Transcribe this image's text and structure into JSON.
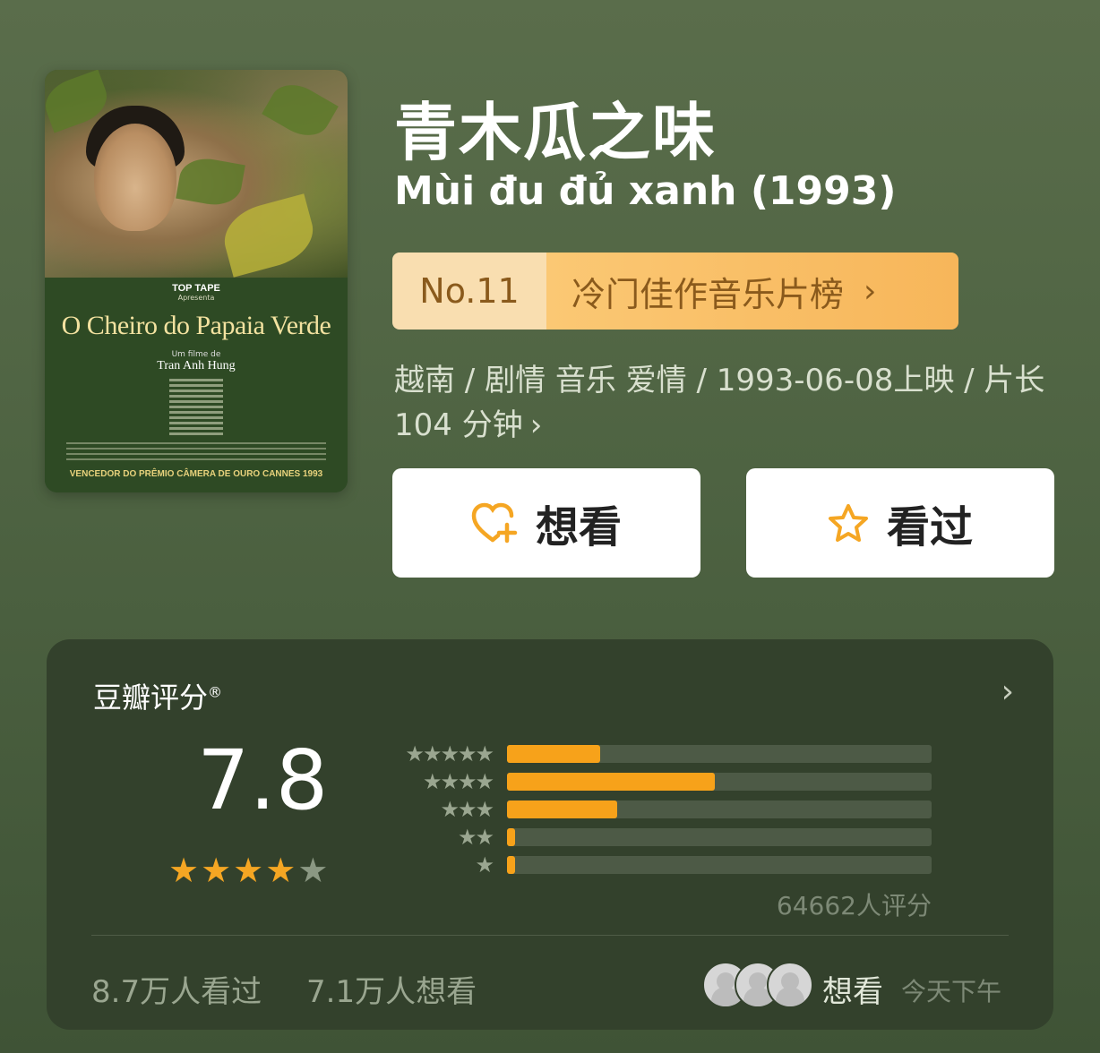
{
  "poster": {
    "brand": "TOP TAPE",
    "apresenta": "Apresenta",
    "title": "O Cheiro do Papaia Verde",
    "film_by": "Um filme de",
    "director": "Tran Anh Hung",
    "award": "VENCEDOR DO PRÊMIO CÂMERA DE OURO CANNES 1993"
  },
  "movie": {
    "title_cn": "青木瓜之味",
    "title_original": "Mùi đu đủ xanh (1993)"
  },
  "rank": {
    "number": "No.11",
    "list_name": "冷门佳作音乐片榜",
    "chevron": "›"
  },
  "meta": {
    "text": "越南 / 剧情 音乐 爱情 / 1993-06-08上映 / 片长104 分钟",
    "chevron": "›"
  },
  "actions": {
    "want_label": "想看",
    "want_icon": "heart-plus-icon",
    "seen_label": "看过",
    "seen_icon": "star-outline-icon",
    "accent_color": "#f5a623"
  },
  "rating": {
    "title": "豆瓣评分",
    "registered": "®",
    "chevron": "›",
    "score": "7.8",
    "stars_filled": 4,
    "stars_total": 5,
    "distribution": [
      {
        "stars": "★★★★★",
        "percent": 22
      },
      {
        "stars": "★★★★",
        "percent": 49
      },
      {
        "stars": "★★★",
        "percent": 26
      },
      {
        "stars": "★★",
        "percent": 2
      },
      {
        "stars": "★",
        "percent": 0.4
      }
    ],
    "count_text": "64662人评分"
  },
  "footer": {
    "seen_text": "8.7万人看过",
    "want_text": "7.1万人想看",
    "activity_action": "想看",
    "activity_time": "今天下午"
  }
}
